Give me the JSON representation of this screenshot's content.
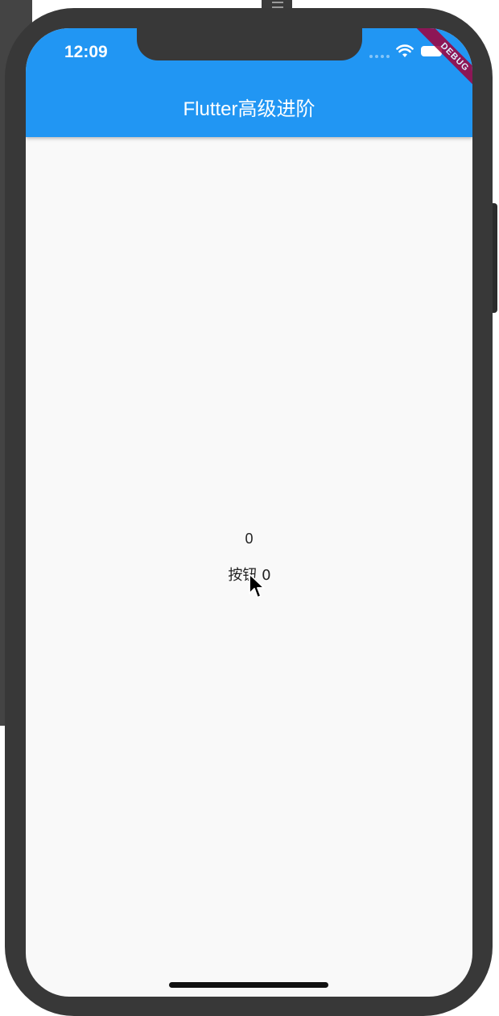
{
  "status_bar": {
    "time": "12:09",
    "wifi_icon": "wifi-icon",
    "battery_icon": "battery-icon"
  },
  "debug_banner": "DEBUG",
  "app_bar": {
    "title": "Flutter高级进阶",
    "background": "#2196f3"
  },
  "body": {
    "counter_value": "0",
    "button_label": "按钮 0"
  },
  "colors": {
    "frame": "#383838",
    "screen_bg": "#f9f9f9",
    "debug_ribbon": "#a0003a"
  }
}
